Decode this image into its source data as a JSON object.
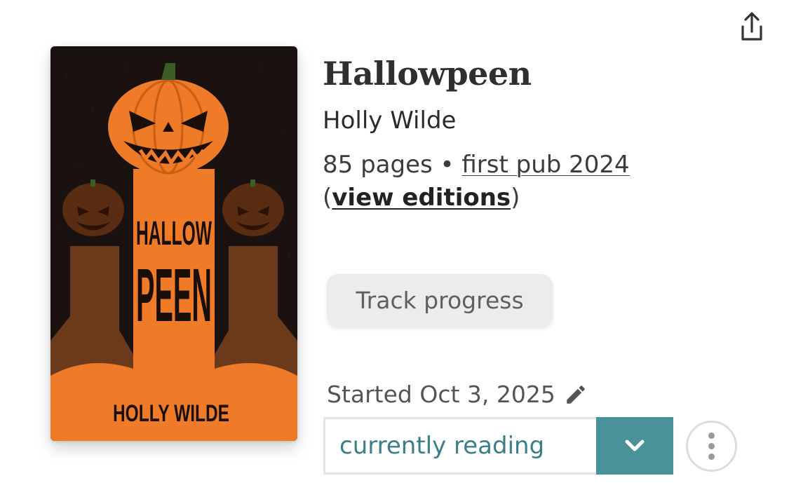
{
  "book": {
    "title": "Hallowpeen",
    "author": "Holly Wilde",
    "pages": "85 pages",
    "separator": " • ",
    "first_pub": "first pub 2024",
    "edition_open": "(",
    "view_editions": "view editions",
    "edition_close": ")"
  },
  "cover": {
    "line1": "HALLOW",
    "line2": "PEEN",
    "author": "HOLLY WILDE",
    "colors": {
      "orange": "#ef7b29",
      "dark": "#1a1210",
      "brown": "#6b3a1a"
    }
  },
  "actions": {
    "track_progress": "Track progress",
    "started": "Started Oct 3, 2025",
    "status": "currently reading"
  },
  "icons": {
    "share": "share-icon",
    "edit": "pencil-icon",
    "dropdown": "chevron-down-icon",
    "more": "more-vertical-icon"
  },
  "colors": {
    "accent": "#4a9299",
    "status_text": "#3a7f86"
  }
}
